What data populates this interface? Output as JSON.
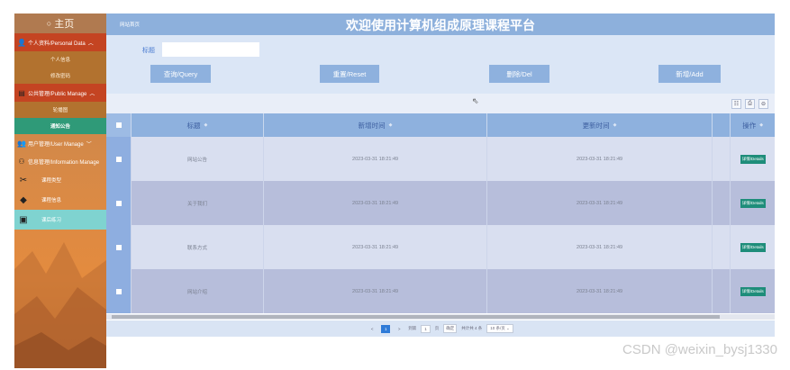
{
  "sidebar": {
    "home_label": "主页",
    "groups": [
      {
        "label": "个人资料/Personal Data",
        "icon": "user-icon",
        "items": [
          "个人信息",
          "修改密码"
        ]
      },
      {
        "label": "公共管理/Public Manage",
        "icon": "board-icon",
        "items": [
          "轮播图",
          "通知公告"
        ],
        "active": "通知公告"
      },
      {
        "label": "用户管理/User Manage",
        "icon": "users-icon"
      },
      {
        "label": "信息管理/Information Manage",
        "icon": "org-icon"
      }
    ],
    "plain_items": [
      {
        "label": "课程类型",
        "icon": "tools-icon"
      },
      {
        "label": "课程信息",
        "icon": "tag-icon"
      },
      {
        "label": "课后练习",
        "icon": "chat-icon"
      }
    ]
  },
  "header": {
    "breadcrumb": "网站首页",
    "title": "欢迎使用计算机组成原理课程平台"
  },
  "search": {
    "field_label": "标题",
    "field_value": "",
    "buttons": [
      "查询/Query",
      "重置/Reset",
      "删除/Del",
      "新增/Add"
    ]
  },
  "toolbar": {
    "icons": [
      "filter-icon",
      "print-icon",
      "export-icon"
    ]
  },
  "table": {
    "headers": [
      "标题",
      "新增时间",
      "更新时间",
      "操作"
    ],
    "rows": [
      {
        "title": "网站公告",
        "created": "2023-03-31 18:21:49",
        "updated": "2023-03-31 18:21:49",
        "action": "详情/Details"
      },
      {
        "title": "关于我们",
        "created": "2023-03-31 18:21:49",
        "updated": "2023-03-31 18:21:49",
        "action": "详情/Details"
      },
      {
        "title": "联系方式",
        "created": "2023-03-31 18:21:49",
        "updated": "2023-03-31 18:21:49",
        "action": "详情/Details"
      },
      {
        "title": "网站介绍",
        "created": "2023-03-31 18:21:49",
        "updated": "2023-03-31 18:21:49",
        "action": "详情/Details"
      }
    ]
  },
  "pager": {
    "prev": "<",
    "current_page": "1",
    "next": ">",
    "goto_label": "到第",
    "goto_value": "1",
    "page_unit": "页",
    "confirm": "确定",
    "total": "共计共 4 条",
    "page_size": "10 条/页"
  },
  "watermark": "CSDN @weixin_bysj1330",
  "colors": {
    "header": "#8db0dc",
    "sidebar_group": "#c44422",
    "active_item": "#2f9a78",
    "detail_button": "#1e8d7a",
    "current_page": "#2f7bd8"
  }
}
